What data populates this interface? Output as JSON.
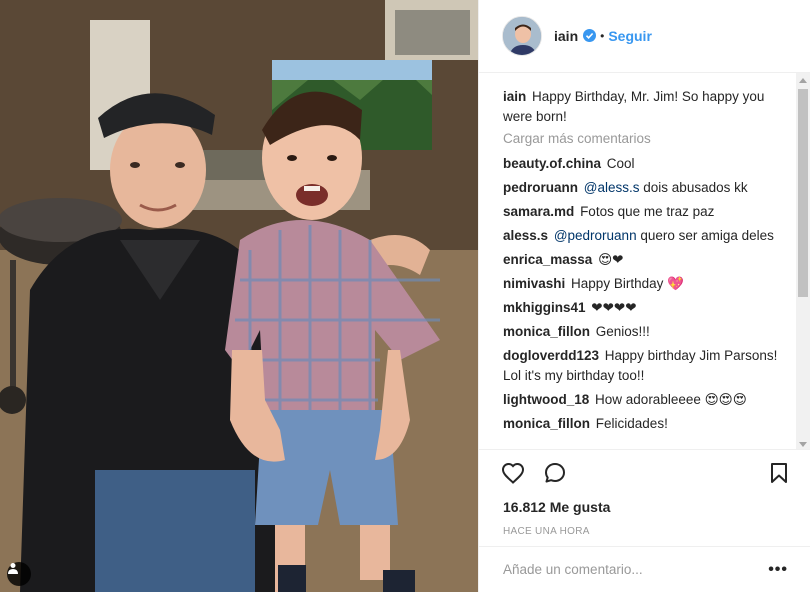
{
  "post": {
    "author": "iain",
    "follow_label": "Seguir",
    "separator": "•",
    "caption_user": "iain",
    "caption_text": "Happy Birthday, Mr. Jim! So happy you were born!",
    "load_more": "Cargar más comentarios",
    "comments": [
      {
        "user": "beauty.of.china",
        "text": "Cool"
      },
      {
        "user": "pedroruann",
        "mention": "@aless.s",
        "text": "dois abusados kk"
      },
      {
        "user": "samara.md",
        "text": "Fotos que me traz paz"
      },
      {
        "user": "aless.s",
        "mention": "@pedroruann",
        "text": "quero ser amiga deles"
      },
      {
        "user": "enrica_massa",
        "text": "😍❤"
      },
      {
        "user": "nimivashi",
        "text": "Happy Birthday 💖"
      },
      {
        "user": "mkhiggins41",
        "text": "❤❤❤❤"
      },
      {
        "user": "monica_fillon",
        "text": "Genios!!!"
      },
      {
        "user": "dogloverdd123",
        "text": "Happy birthday Jim Parsons! Lol it's my birthday too!!"
      },
      {
        "user": "lightwood_18",
        "text": "How adorableeee 😍😍😍"
      },
      {
        "user": "monica_fillon",
        "text": "Felicidades!"
      }
    ],
    "likes": "16.812 Me gusta",
    "timestamp": "HACE UNA HORA",
    "add_comment_placeholder": "Añade un comentario...",
    "more_options": "•••"
  },
  "icons": {
    "verified": "verified-badge-icon",
    "like": "heart-icon",
    "comment": "comment-bubble-icon",
    "save": "bookmark-icon",
    "user_tag": "user-tag-icon"
  },
  "colors": {
    "accent": "#3897f0",
    "mention": "#003569",
    "muted": "#999999",
    "text": "#262626"
  }
}
